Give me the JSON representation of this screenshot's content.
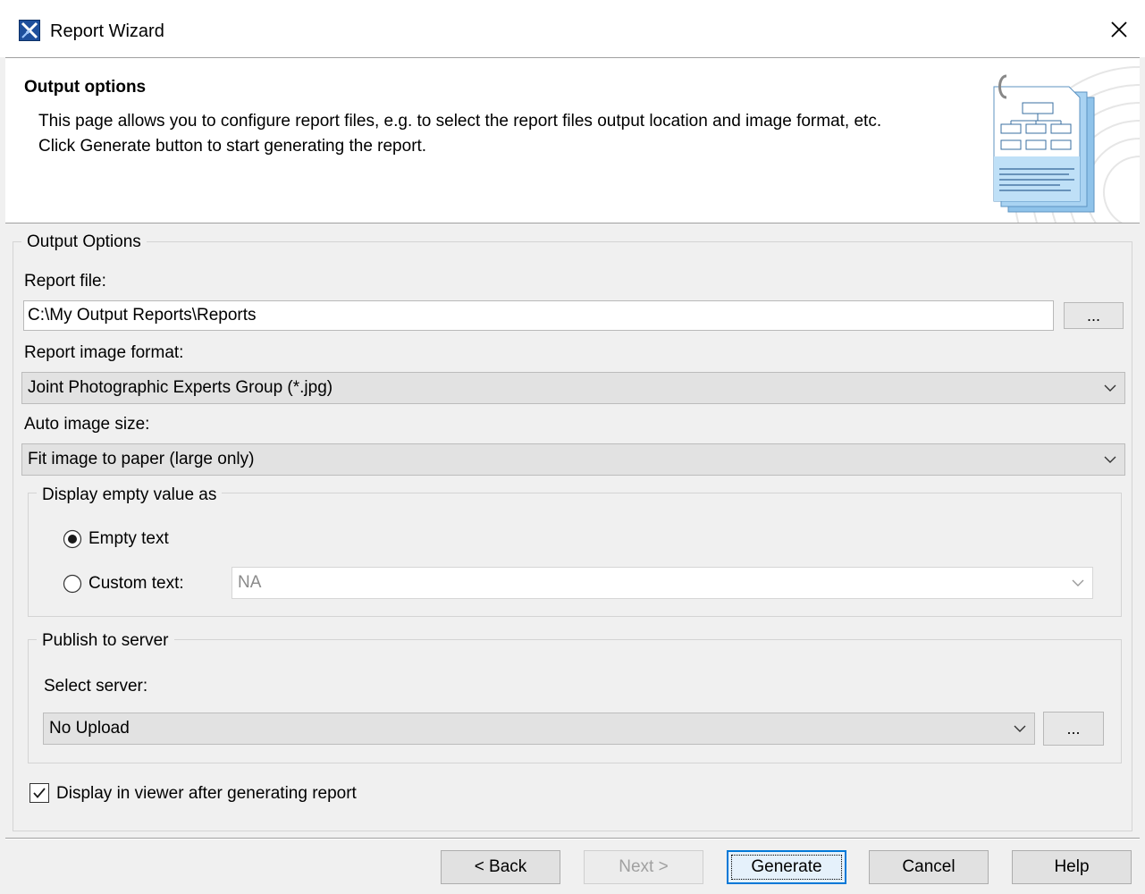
{
  "window": {
    "title": "Report Wizard"
  },
  "header": {
    "title": "Output options",
    "line1": "This page allows you to configure report files, e.g. to select the report files output location and image format, etc.",
    "line2": "Click Generate button to start generating the report."
  },
  "output_options": {
    "legend": "Output Options",
    "report_file_label": "Report file:",
    "report_file_value": "C:\\My Output Reports\\Reports",
    "browse_label": "...",
    "image_format_label": "Report image format:",
    "image_format_value": "Joint Photographic Experts Group (*.jpg)",
    "auto_size_label": "Auto image size:",
    "auto_size_value": "Fit image to paper (large only)"
  },
  "empty_value": {
    "legend": "Display empty value as",
    "empty_text_label": "Empty text",
    "empty_text_selected": true,
    "custom_text_label": "Custom text:",
    "custom_text_selected": false,
    "custom_text_value": "NA"
  },
  "publish": {
    "legend": "Publish to server",
    "select_label": "Select server:",
    "server_value": "No Upload",
    "browse_label": "..."
  },
  "display_viewer": {
    "label": "Display in viewer after generating report",
    "checked": true
  },
  "buttons": {
    "back": "< Back",
    "next": "Next >",
    "generate": "Generate",
    "cancel": "Cancel",
    "help": "Help"
  },
  "colors": {
    "accent": "#0078d7",
    "window_bg": "#f0f0f0"
  }
}
